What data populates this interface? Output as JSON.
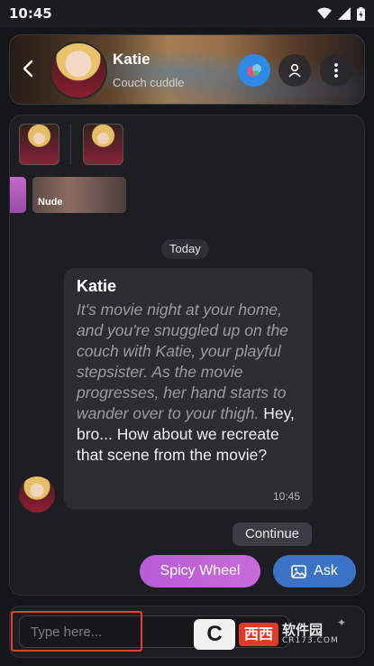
{
  "status_bar": {
    "time": "10:45",
    "icons": [
      "wifi-icon",
      "signal-icon",
      "battery-icon"
    ]
  },
  "header": {
    "back_icon": "chevron-left-icon",
    "name": "Katie",
    "subtitle": "Couch cuddle",
    "actions": [
      "gem-icon",
      "profile-icon",
      "more-vertical-icon"
    ],
    "accent": "#2d8ae6"
  },
  "media": {
    "thumbnails": [
      "character-thumbnail",
      "character-thumbnail"
    ],
    "card_label": "Nude"
  },
  "chat": {
    "date_label": "Today",
    "message": {
      "sender": "Katie",
      "narration": "It's movie night at your home, and you're snuggled up on the couch with Katie, your playful stepsister. As the movie progresses, her hand starts to wander over to your thigh.",
      "dialogue": "Hey, bro... How about we recreate that scene from the movie?",
      "time": "10:45"
    },
    "continue_label": "Continue",
    "spicy_wheel_label": "Spicy Wheel",
    "ask_label": "Ask",
    "spicy_color": "#c062d6",
    "ask_color": "#3a72c6"
  },
  "input": {
    "placeholder": "Type here...",
    "value": ""
  },
  "watermark": {
    "logo": "C",
    "red_text": "西西",
    "brand": "软件园",
    "domain": "CR173.COM"
  },
  "highlight_color": "#e5412d"
}
